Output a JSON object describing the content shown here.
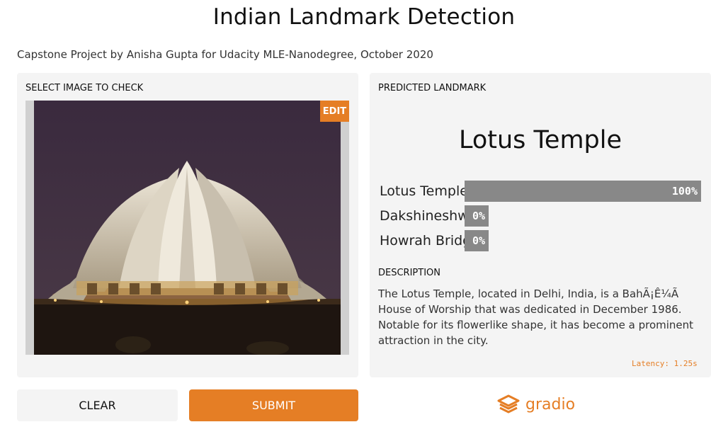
{
  "header": {
    "title": "Indian Landmark Detection",
    "subtitle": "Capstone Project by Anisha Gupta for Udacity MLE-Nanodegree, October 2020"
  },
  "input_panel": {
    "label": "SELECT IMAGE TO CHECK",
    "edit_label": "EDIT",
    "image_icon": "lotus-temple-photo"
  },
  "output_panel": {
    "label": "PREDICTED LANDMARK",
    "prediction": "Lotus Temple",
    "confidences": [
      {
        "label": "Lotus Temple",
        "value_text": "100%",
        "fraction": 1.0
      },
      {
        "label": "Dakshineshwar",
        "value_text": "0%",
        "fraction": 0.0
      },
      {
        "label": "Howrah Bridge",
        "value_text": "0%",
        "fraction": 0.0
      }
    ],
    "description_label": "DESCRIPTION",
    "description": "The Lotus Temple, located in Delhi, India, is a BahÃ¡Ê¼Ã House of Worship that was dedicated in December 1986. Notable for its flowerlike shape, it has become a prominent attraction in the city.",
    "latency": "Latency: 1.25s"
  },
  "actions": {
    "clear_label": "CLEAR",
    "submit_label": "SUBMIT"
  },
  "branding": {
    "logo_text": "gradio",
    "logo_icon": "gradio-logo-icon"
  },
  "colors": {
    "accent": "#e57e25",
    "panel_bg": "#f4f4f4",
    "bar": "#888888"
  }
}
